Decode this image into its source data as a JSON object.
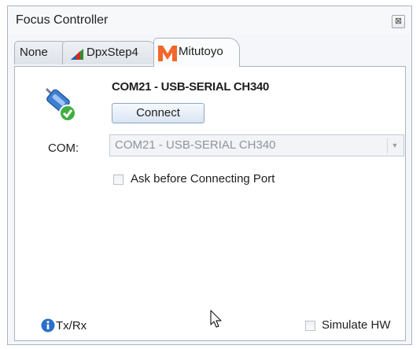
{
  "window": {
    "title": "Focus Controller",
    "close_glyph": "⊠"
  },
  "tabs": [
    {
      "label": "None",
      "icon": "none"
    },
    {
      "label": "DpxStep4",
      "icon": "dpxstep4-logo-icon"
    },
    {
      "label": "Mitutoyo",
      "icon": "mitutoyo-logo-icon",
      "active": true
    }
  ],
  "port": {
    "title": "COM21 - USB-SERIAL CH340",
    "connect_label": "Connect",
    "com_label": "COM:",
    "selected": "COM21 - USB-SERIAL CH340",
    "ask_label": "Ask before Connecting Port",
    "ask_checked": false
  },
  "footer": {
    "txrx_label": "Tx/Rx",
    "simulate_label": "Simulate HW",
    "simulate_checked": false
  }
}
